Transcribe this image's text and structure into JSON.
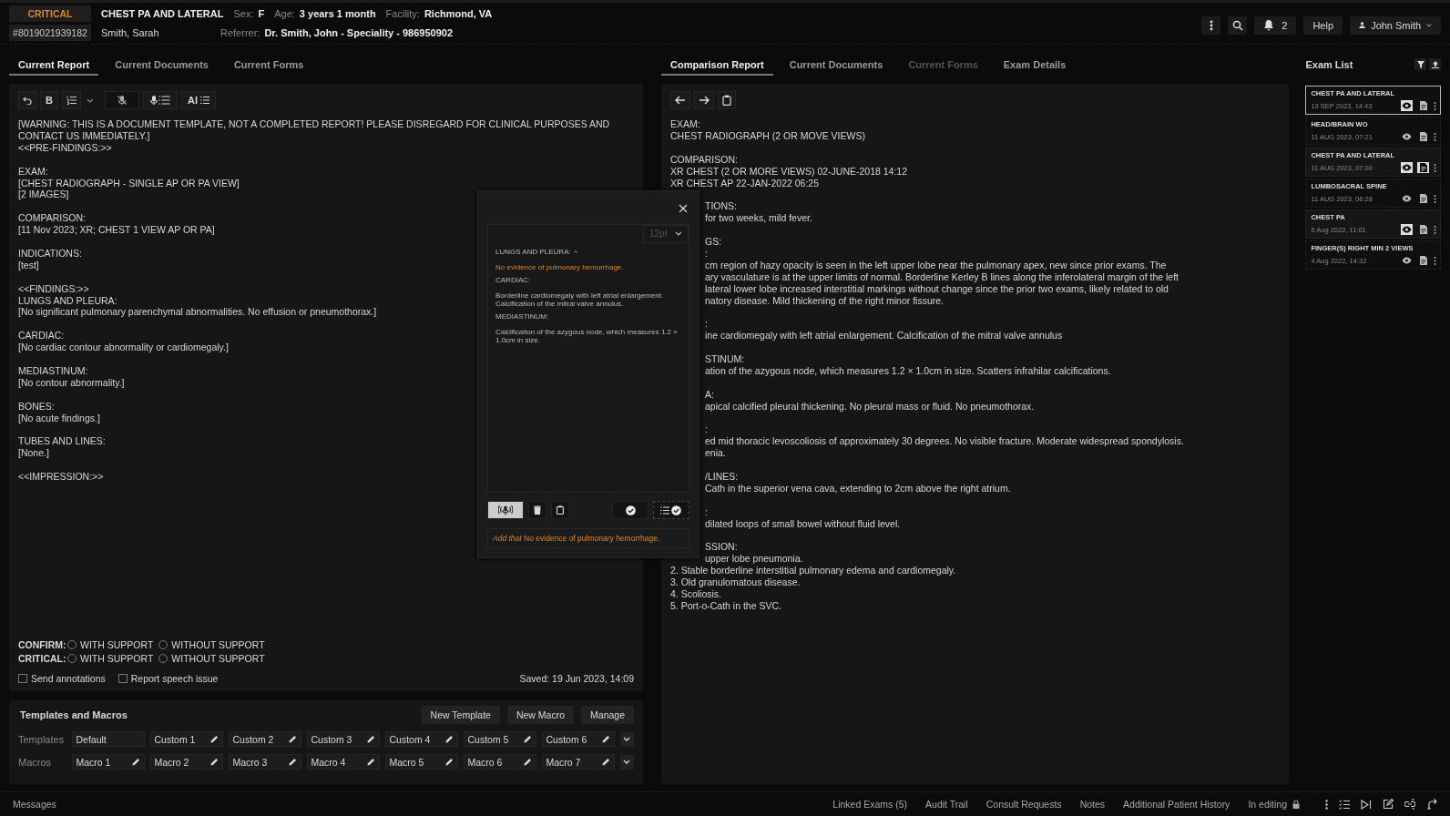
{
  "header": {
    "priority": "CRITICAL",
    "exam": "CHEST PA AND LATERAL",
    "fields": [
      {
        "label": "Sex:",
        "value": "F"
      },
      {
        "label": "Age:",
        "value": "3 years 1 month"
      },
      {
        "label": "Facility:",
        "value": "Richmond, VA"
      }
    ],
    "accession": "#8019021939182",
    "patient": "Smith, Sarah",
    "referrer": {
      "label": "Referrer:",
      "value": "Dr. Smith, John - Speciality - 986950902"
    },
    "notifications": "2",
    "help": "Help",
    "user": "John Smith"
  },
  "left_tabs": [
    {
      "label": "Current Report",
      "selected": true,
      "disabled": false
    },
    {
      "label": "Current Documents",
      "selected": false,
      "disabled": false
    },
    {
      "label": "Current Forms",
      "selected": false,
      "disabled": false
    }
  ],
  "editor": {
    "toolbar": {
      "bold": "B",
      "ai": "AI"
    },
    "blocks": [
      [
        "[WARNING: THIS IS A DOCUMENT TEMPLATE, NOT A COMPLETED REPORT! PLEASE DISREGARD FOR CLINICAL PURPOSES AND CONTACT US IMMEDIATELY.]",
        "<<PRE-FINDINGS:>>"
      ],
      [
        "EXAM:",
        "[CHEST RADIOGRAPH - SINGLE AP OR PA VIEW]",
        "[2 IMAGES]"
      ],
      [
        "COMPARISON:",
        "[11 Nov 2023; XR; CHEST 1 VIEW AP OR PA]"
      ],
      [
        "INDICATIONS:",
        "[test]"
      ],
      [
        "<<FINDINGS:>>",
        "LUNGS AND PLEURA:",
        "[No significant pulmonary parenchymal abnormalities. No effusion or pneumothorax.]"
      ],
      [
        "CARDIAC:",
        "[No cardiac contour abnormality or cardiomegaly.]"
      ],
      [
        "MEDIASTINUM:",
        "[No contour abnormality.]"
      ],
      [
        "BONES:",
        "[No acute findings.]"
      ],
      [
        "TUBES AND LINES:",
        "[None.]"
      ],
      [
        "<<IMPRESSION:>>"
      ]
    ],
    "confirm": [
      {
        "label": "CONFIRM:",
        "options": [
          {
            "label": "WITH SUPPORT",
            "selected": false
          },
          {
            "label": "WITHOUT SUPPORT",
            "selected": false
          }
        ]
      },
      {
        "label": "CRITICAL:",
        "options": [
          {
            "label": "WITH SUPPORT",
            "selected": false
          },
          {
            "label": "WITHOUT SUPPORT",
            "selected": false
          }
        ]
      }
    ],
    "checkboxes": [
      {
        "label": "Send annotations",
        "checked": false
      },
      {
        "label": "Report speech issue",
        "checked": false
      }
    ],
    "saved": "Saved: 19 Jun 2023, 14:09"
  },
  "templates": {
    "title": "Templates and Macros",
    "buttons": [
      "New Template",
      "New Macro",
      "Manage"
    ],
    "rows": [
      {
        "label": "Templates",
        "items": [
          {
            "name": "Default",
            "editable": false
          },
          {
            "name": "Custom 1",
            "editable": true
          },
          {
            "name": "Custom 2",
            "editable": true
          },
          {
            "name": "Custom 3",
            "editable": true
          },
          {
            "name": "Custom 4",
            "editable": true
          },
          {
            "name": "Custom 5",
            "editable": true
          },
          {
            "name": "Custom 6",
            "editable": true
          }
        ]
      },
      {
        "label": "Macros",
        "items": [
          {
            "name": "Macro 1",
            "editable": true
          },
          {
            "name": "Macro 2",
            "editable": true
          },
          {
            "name": "Macro 3",
            "editable": true
          },
          {
            "name": "Macro 4",
            "editable": true
          },
          {
            "name": "Macro 5",
            "editable": true
          },
          {
            "name": "Macro 6",
            "editable": true
          },
          {
            "name": "Macro 7",
            "editable": true
          }
        ]
      }
    ]
  },
  "right_tabs": [
    {
      "label": "Comparison Report",
      "selected": true,
      "disabled": false
    },
    {
      "label": "Current Documents",
      "selected": false,
      "disabled": false
    },
    {
      "label": "Current Forms",
      "selected": false,
      "disabled": true
    },
    {
      "label": "Exam Details",
      "selected": false,
      "disabled": false
    }
  ],
  "comparison": {
    "blocks": [
      [
        {
          "text": "EXAM:",
          "covered": false
        },
        {
          "text": "CHEST RADIOGRAPH (2 OR MOVE VIEWS)",
          "covered": false
        }
      ],
      [
        {
          "text": "COMPARISON:",
          "covered": false
        },
        {
          "text": "XR CHEST (2 OR MORE VIEWS)  02-JUNE-2018 14:12",
          "covered": false
        },
        {
          "text": "XR CHEST AP 22-JAN-2022 06:25",
          "covered": false
        }
      ],
      [
        {
          "text": "TIONS:",
          "covered": true
        },
        {
          "text": "for two weeks, mild fever.",
          "covered": true
        }
      ],
      [
        {
          "text": "GS:",
          "covered": true
        },
        {
          "text": ":",
          "covered": true
        },
        {
          "text": "cm region of hazy opacity is seen in the left upper lobe near the pulmonary apex, new since prior exams.  The",
          "covered": true
        },
        {
          "text": "ary vasculature is at the upper limits of normal. Borderline Kerley B lines along the inferolateral margin of the left",
          "covered": true
        },
        {
          "text": "lateral lower lobe increased interstitial markings without change since the prior two exams, likely related to old",
          "covered": true
        },
        {
          "text": "natory disease. Mild thickening of the right minor fissure.",
          "covered": true
        }
      ],
      [
        {
          "text": ":",
          "covered": true
        },
        {
          "text": "ine cardiomegaly with left atrial enlargement. Calcification of the mitral valve annulus",
          "covered": true
        }
      ],
      [
        {
          "text": "STINUM:",
          "covered": true
        },
        {
          "text": "ation of the azygous node, which measures 1.2 × 1.0cm in size. Scatters infrahilar calcifications.",
          "covered": true
        }
      ],
      [
        {
          "text": "A:",
          "covered": true
        },
        {
          "text": "apical calcified pleural thickening.  No pleural mass or fluid.  No pneumothorax.",
          "covered": true
        }
      ],
      [
        {
          "text": ":",
          "covered": true
        },
        {
          "text": "ed mid thoracic levoscoliosis of approximately 30 degrees. No visible fracture. Moderate widespread spondylosis.",
          "covered": true
        },
        {
          "text": "enia.",
          "covered": true
        }
      ],
      [
        {
          "text": "/LINES:",
          "covered": true
        },
        {
          "text": "Cath in the superior vena cava, extending to 2cm above the right atrium.",
          "covered": true
        }
      ],
      [
        {
          "text": ":",
          "covered": true
        },
        {
          "text": "dilated loops of small bowel without fluid level.",
          "covered": true
        }
      ],
      [
        {
          "text": "SSION:",
          "covered": true
        },
        {
          "text": "upper lobe pneumonia.",
          "covered": true
        },
        {
          "text": "2. Stable borderline interstitial pulmonary edema and cardiomegaly.",
          "covered": false
        },
        {
          "text": "3. Old granulomatous disease.",
          "covered": false
        },
        {
          "text": "4. Scoliosis.",
          "covered": false
        },
        {
          "text": "5. Port-o-Cath in the SVC.",
          "covered": false
        }
      ]
    ]
  },
  "popup": {
    "font_size": "12pt",
    "listening": true,
    "sections": [
      {
        "heading": "LUNGS AND PLEURA:",
        "marker": "+",
        "text": "No evidence of pulmonary hemorrhage.",
        "highlighted": true
      },
      {
        "heading": "CARDIAC:",
        "text": "Borderline cardiomegaly with left atrial enlargement. Calcification of the mitral valve annulus.",
        "highlighted": false
      },
      {
        "heading": "MEDIASTINUM:",
        "text": "Calcification of the azygous node, which measures 1.2 × 1.0cm in size.",
        "highlighted": false
      }
    ],
    "command": "*Add that* No evidence of pulmonary hemorrhage."
  },
  "exam_list": {
    "title": "Exam List",
    "items": [
      {
        "title": "CHEST PA AND LATERAL",
        "date": "13 SEP 2023, 14:43",
        "selected": true,
        "current": false,
        "viewed": true,
        "report_open": false
      },
      {
        "title": "HEAD/BRAIN WO",
        "date": "11 AUG 2023, 07:21",
        "selected": false,
        "current": false,
        "viewed": false,
        "report_open": false
      },
      {
        "title": "CHEST PA AND LATERAL",
        "date": "11 AUG 2023, 07:00",
        "selected": false,
        "current": true,
        "viewed": true,
        "report_open": true
      },
      {
        "title": "LUMBOSACRAL SPINE",
        "date": "11 AUG 2023, 06:28",
        "selected": false,
        "current": false,
        "viewed": false,
        "report_open": false
      },
      {
        "title": "CHEST PA",
        "date": "5 Aug 2022, 11:01",
        "selected": false,
        "current": true,
        "viewed": true,
        "report_open": false
      },
      {
        "title": "FINGER(S) RIGHT MIN 2 VIEWS",
        "date": "4 Aug 2022, 14:32",
        "selected": false,
        "current": false,
        "viewed": false,
        "report_open": false
      }
    ]
  },
  "status_bar": {
    "messages": "Messages",
    "links": [
      "Linked Exams (5)",
      "Audit Trail",
      "Consult Requests",
      "Notes",
      "Additional Patient History"
    ],
    "editing": "In editing"
  }
}
